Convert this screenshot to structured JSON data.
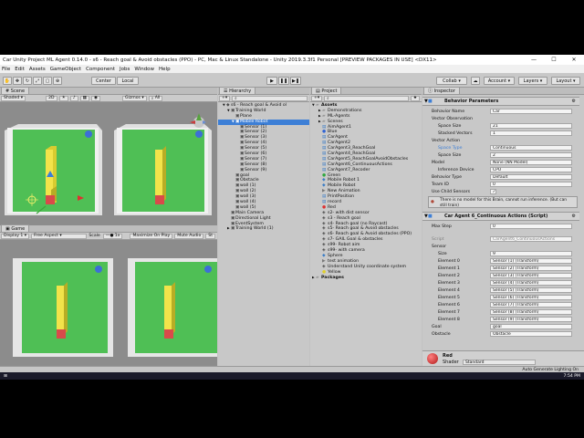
{
  "window": {
    "title": "Car Unity Project ML Agent 0.14.0 - s6 - Reach goal & Avoid obstacles (PPO) - PC, Mac & Linux Standalone - Unity 2019.3.3f1 Personal [PREVIEW PACKAGES IN USE] <DX11>",
    "min": "—",
    "max": "☐",
    "close": "✕"
  },
  "menu": [
    "File",
    "Edit",
    "Assets",
    "GameObject",
    "Component",
    "Jobs",
    "Window",
    "Help"
  ],
  "toolbar": {
    "center": "Center",
    "local": "Local",
    "collab": "Collab",
    "account": "Account",
    "layers": "Layers",
    "layout": "Layout"
  },
  "scene": {
    "tab": "Scene",
    "shading": "Shaded",
    "mode": "2D",
    "gizmos": "Gizmos",
    "search": "All"
  },
  "game": {
    "tab": "Game",
    "display": "Display 1",
    "aspect": "Free Aspect",
    "scale_label": "Scale",
    "scale_value": "1x",
    "maximize": "Maximize On Play",
    "mute": "Mute Audio",
    "stats": "St"
  },
  "hierarchy": {
    "tab": "Hierarchy",
    "items": [
      {
        "label": "s6 - Reach goal & Avoid ol",
        "indent": 1,
        "arrow": "▼"
      },
      {
        "label": "Training World",
        "indent": 2,
        "arrow": "▼"
      },
      {
        "label": "Plane",
        "indent": 3,
        "arrow": ""
      },
      {
        "label": "Mobile Robot",
        "indent": 3,
        "arrow": "▼",
        "selected": true
      },
      {
        "label": "Sensor (1)",
        "indent": 4,
        "arrow": ""
      },
      {
        "label": "Sensor (2)",
        "indent": 4,
        "arrow": ""
      },
      {
        "label": "Sensor (3)",
        "indent": 4,
        "arrow": ""
      },
      {
        "label": "Sensor (4)",
        "indent": 4,
        "arrow": ""
      },
      {
        "label": "Sensor (5)",
        "indent": 4,
        "arrow": ""
      },
      {
        "label": "Sensor (6)",
        "indent": 4,
        "arrow": ""
      },
      {
        "label": "Sensor (7)",
        "indent": 4,
        "arrow": ""
      },
      {
        "label": "Sensor (8)",
        "indent": 4,
        "arrow": ""
      },
      {
        "label": "Sensor (9)",
        "indent": 4,
        "arrow": ""
      },
      {
        "label": "goal",
        "indent": 3,
        "arrow": ""
      },
      {
        "label": "Obstacle",
        "indent": 3,
        "arrow": ""
      },
      {
        "label": "wall (1)",
        "indent": 3,
        "arrow": ""
      },
      {
        "label": "wall (2)",
        "indent": 3,
        "arrow": ""
      },
      {
        "label": "wall (3)",
        "indent": 3,
        "arrow": ""
      },
      {
        "label": "wall (4)",
        "indent": 3,
        "arrow": ""
      },
      {
        "label": "wall (5)",
        "indent": 3,
        "arrow": ""
      },
      {
        "label": "Main Camera",
        "indent": 2,
        "arrow": ""
      },
      {
        "label": "Directional Light",
        "indent": 2,
        "arrow": ""
      },
      {
        "label": "EventSystem",
        "indent": 2,
        "arrow": ""
      },
      {
        "label": "Training World (1)",
        "indent": 2,
        "arrow": "▶"
      }
    ]
  },
  "project": {
    "tab": "Project",
    "items": [
      {
        "label": "Assets",
        "indent": 0,
        "kind": "folder",
        "arrow": "▼"
      },
      {
        "label": "Demonstrations",
        "indent": 1,
        "kind": "folder",
        "arrow": "▶"
      },
      {
        "label": "ML-Agents",
        "indent": 1,
        "kind": "folder",
        "arrow": "▶"
      },
      {
        "label": "Scenes",
        "indent": 1,
        "kind": "folder",
        "arrow": "▶"
      },
      {
        "label": "AimAgent1",
        "indent": 1,
        "kind": "script",
        "arrow": ""
      },
      {
        "label": "Blue",
        "indent": 1,
        "kind": "blue",
        "arrow": ""
      },
      {
        "label": "CarAgent",
        "indent": 1,
        "kind": "script",
        "arrow": ""
      },
      {
        "label": "CarAgent2",
        "indent": 1,
        "kind": "script",
        "arrow": ""
      },
      {
        "label": "CarAgent3_ReachGoal",
        "indent": 1,
        "kind": "script",
        "arrow": ""
      },
      {
        "label": "CarAgent4_ReachGoal",
        "indent": 1,
        "kind": "script",
        "arrow": ""
      },
      {
        "label": "CarAgent5_ReachGoalAvoidObstacles",
        "indent": 1,
        "kind": "script",
        "arrow": ""
      },
      {
        "label": "CarAgent6_ContinuousActions",
        "indent": 1,
        "kind": "script",
        "arrow": ""
      },
      {
        "label": "CarAgent7_Recoder",
        "indent": 1,
        "kind": "script",
        "arrow": ""
      },
      {
        "label": "Green",
        "indent": 1,
        "kind": "green",
        "arrow": ""
      },
      {
        "label": "Mobile Robot 1",
        "indent": 1,
        "kind": "prefab",
        "arrow": ""
      },
      {
        "label": "Mobile Robot",
        "indent": 1,
        "kind": "prefab",
        "arrow": ""
      },
      {
        "label": "New Animation",
        "indent": 1,
        "kind": "anim",
        "arrow": ""
      },
      {
        "label": "PrintPosition",
        "indent": 1,
        "kind": "script",
        "arrow": ""
      },
      {
        "label": "record",
        "indent": 1,
        "kind": "script",
        "arrow": ""
      },
      {
        "label": "Red",
        "indent": 1,
        "kind": "red",
        "arrow": ""
      },
      {
        "label": "s2- with dist sensor",
        "indent": 1,
        "kind": "scene",
        "arrow": ""
      },
      {
        "label": "s3 - Reach goal",
        "indent": 1,
        "kind": "scene",
        "arrow": ""
      },
      {
        "label": "s4- Reach goal (no Raycast)",
        "indent": 1,
        "kind": "scene",
        "arrow": ""
      },
      {
        "label": "s5- Reach goal & Avoid obstacles",
        "indent": 1,
        "kind": "scene",
        "arrow": ""
      },
      {
        "label": "s6- Reach goal & Avoid obstacles (PPO)",
        "indent": 1,
        "kind": "scene",
        "arrow": ""
      },
      {
        "label": "s7- GAIL Goal & obstacles",
        "indent": 1,
        "kind": "scene",
        "arrow": ""
      },
      {
        "label": "s99- Robot aim",
        "indent": 1,
        "kind": "scene",
        "arrow": ""
      },
      {
        "label": "s99- with camera",
        "indent": 1,
        "kind": "scene",
        "arrow": ""
      },
      {
        "label": "Sphere",
        "indent": 1,
        "kind": "prefab",
        "arrow": ""
      },
      {
        "label": "test animation",
        "indent": 1,
        "kind": "anim",
        "arrow": ""
      },
      {
        "label": "Understand Unity coordinate system",
        "indent": 1,
        "kind": "scene",
        "arrow": ""
      },
      {
        "label": "Yellow",
        "indent": 1,
        "kind": "yellow",
        "arrow": ""
      },
      {
        "label": "Packages",
        "indent": 0,
        "kind": "folder",
        "arrow": "▶"
      }
    ]
  },
  "inspector": {
    "tab": "Inspector",
    "behavior_header": "Behavior Parameters",
    "behavior_rows": [
      {
        "label": "Behavior Name",
        "value": "Car",
        "indent": 0
      },
      {
        "label": "Vector Observation",
        "value": "",
        "indent": 0
      },
      {
        "label": "Space Size",
        "value": "21",
        "indent": 1
      },
      {
        "label": "Stacked Vectors",
        "value": "1",
        "indent": 1
      },
      {
        "label": "Vector Action",
        "value": "",
        "indent": 0
      },
      {
        "label": "Space Type",
        "value": "Continuous",
        "indent": 1,
        "highlight": true
      },
      {
        "label": "Space Size",
        "value": "2",
        "indent": 1
      },
      {
        "label": "Model",
        "value": "None (NN Model)",
        "indent": 0
      },
      {
        "label": "Inference Device",
        "value": "CPU",
        "indent": 1
      },
      {
        "label": "Behavior Type",
        "value": "Default",
        "indent": 0
      },
      {
        "label": "Team ID",
        "value": "0",
        "indent": 0
      },
      {
        "label": "Use Child Sensors",
        "value": "✓",
        "indent": 0
      }
    ],
    "warning": "There is no model for this Brain, cannot run inference. (But can still train)",
    "agent_header": "Car Agent 6_Continuous Actions (Script)",
    "agent_rows": [
      {
        "label": "Max Step",
        "value": "0",
        "indent": 0
      },
      {
        "label": "Script",
        "value": "CarAgent6_ContinuousActions",
        "indent": 0,
        "greyed": true
      },
      {
        "label": "Sensor",
        "value": "",
        "indent": 0
      },
      {
        "label": "Size",
        "value": "9",
        "indent": 1
      },
      {
        "label": "Element 0",
        "value": "Sensor (1) (Transform)",
        "indent": 1
      },
      {
        "label": "Element 1",
        "value": "Sensor (2) (Transform)",
        "indent": 1
      },
      {
        "label": "Element 2",
        "value": "Sensor (3) (Transform)",
        "indent": 1
      },
      {
        "label": "Element 3",
        "value": "Sensor (4) (Transform)",
        "indent": 1
      },
      {
        "label": "Element 4",
        "value": "Sensor (5) (Transform)",
        "indent": 1
      },
      {
        "label": "Element 5",
        "value": "Sensor (6) (Transform)",
        "indent": 1
      },
      {
        "label": "Element 6",
        "value": "Sensor (7) (Transform)",
        "indent": 1
      },
      {
        "label": "Element 7",
        "value": "Sensor (8) (Transform)",
        "indent": 1
      },
      {
        "label": "Element 8",
        "value": "Sensor (9) (Transform)",
        "indent": 1
      },
      {
        "label": "Goal",
        "value": "goal",
        "indent": 0
      },
      {
        "label": "Obstacle",
        "value": "Obstacle",
        "indent": 0
      }
    ],
    "material_name": "Red",
    "shader_label": "Shader",
    "shader_value": "Standard"
  },
  "status": "Auto Generate Lighting On",
  "clock": "7:54 PM",
  "colors": {
    "accent": "#3d7fd6",
    "grass": "#4fbf55",
    "yellow": "#f2e34a",
    "red": "#d94a4a"
  }
}
